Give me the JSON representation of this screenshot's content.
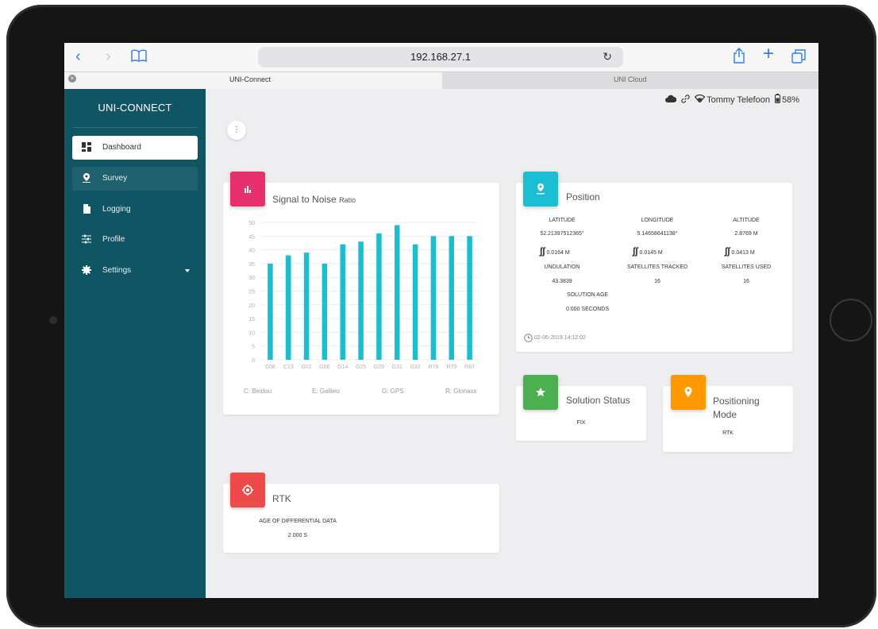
{
  "browser": {
    "url": "192.168.27.1",
    "tabs": [
      {
        "label": "UNI-Connect",
        "active": true
      },
      {
        "label": "UNI Cloud",
        "active": false
      }
    ]
  },
  "sidebar": {
    "brand": "UNI-CONNECT",
    "items": [
      {
        "label": "Dashboard",
        "icon": "dashboard-icon",
        "active": true
      },
      {
        "label": "Survey",
        "icon": "map-pin-icon"
      },
      {
        "label": "Logging",
        "icon": "file-icon"
      },
      {
        "label": "Profile",
        "icon": "sliders-icon"
      },
      {
        "label": "Settings",
        "icon": "gear-icon",
        "has_caret": true
      }
    ]
  },
  "status_bar": {
    "network": "Tommy Telefoon",
    "battery": "58%"
  },
  "snr": {
    "title": "Signal to Noise",
    "title_small": "Ratio",
    "legend": [
      "C: Beidou",
      "E: Galileo",
      "G: GPS",
      "R: Glonass"
    ]
  },
  "chart_data": {
    "type": "bar",
    "title": "Signal to Noise Ratio",
    "categories": [
      "C08",
      "C13",
      "G02",
      "G06",
      "G14",
      "G25",
      "G29",
      "G31",
      "G32",
      "R78",
      "R79",
      "R87"
    ],
    "values": [
      35,
      38,
      39,
      35,
      42,
      43,
      46,
      49,
      42,
      45,
      45,
      45
    ],
    "yticks": [
      0,
      5,
      10,
      15,
      20,
      25,
      30,
      35,
      40,
      45,
      50
    ],
    "ylim": [
      0,
      50
    ],
    "grid": true,
    "color": "#17bfd0"
  },
  "position": {
    "title": "Position",
    "latitude_label": "LATITUDE",
    "latitude": "52.21397512365°",
    "latitude_acc": "0.0164 M",
    "longitude_label": "LONGITUDE",
    "longitude": "5.14658641138°",
    "longitude_acc": "0.0145 M",
    "altitude_label": "ALTITUDE",
    "altitude": "2.8769 M",
    "altitude_acc": "0.0413 M",
    "undulation_label": "UNDULATION",
    "undulation": "43.3839",
    "sats_tracked_label": "SATELLITES TRACKED",
    "sats_tracked": "16",
    "sats_used_label": "SATELLITES USED",
    "sats_used": "16",
    "solution_age_label": "SOLUTION AGE",
    "solution_age": "0.000 SECONDS",
    "timestamp": "02-06-2019 14:12:02"
  },
  "solution_status": {
    "title": "Solution Status",
    "value": "FIX"
  },
  "positioning_mode": {
    "title_line1": "Positioning",
    "title_line2": "Mode",
    "value": "RTK"
  },
  "rtk": {
    "title": "RTK",
    "age_label": "AGE OF DIFFERENTIAL DATA",
    "age_value": "2.000 S"
  },
  "colors": {
    "sidebar": "#0f5563",
    "snr_badge": "#e6316d",
    "position_badge": "#1bbfd4",
    "status_badge": "#4caf50",
    "mode_badge": "#ff9800",
    "rtk_badge": "#ef4a4a"
  }
}
